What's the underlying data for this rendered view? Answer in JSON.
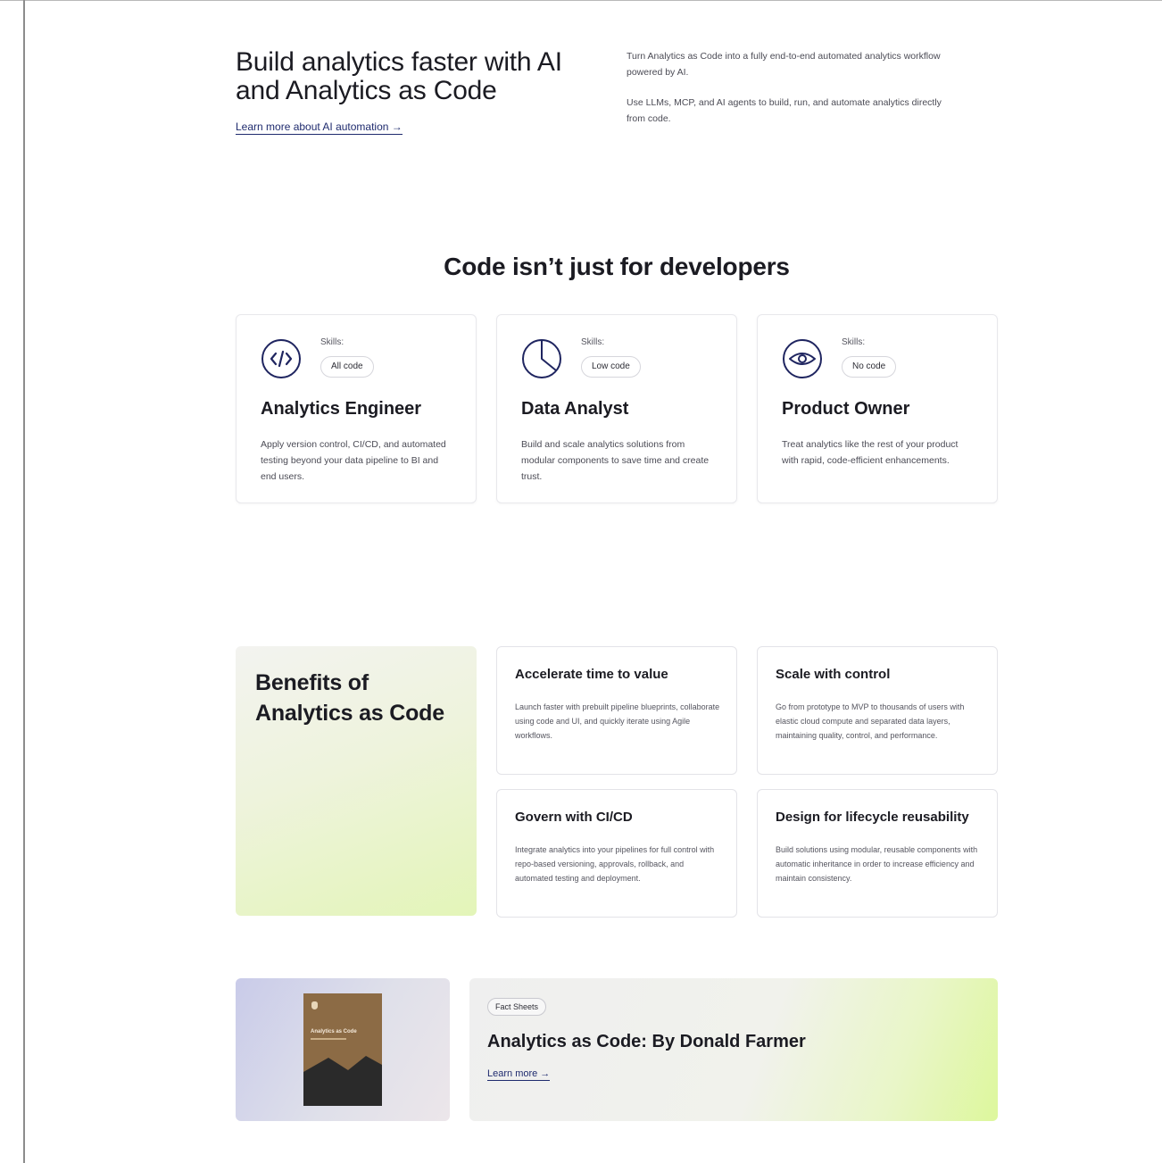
{
  "hero": {
    "title": "Build analytics faster with AI and Analytics as Code",
    "link_label": "Learn more about AI automation →",
    "paragraph_1": "Turn Analytics as Code into a fully end-to-end automated analytics workflow powered by AI.",
    "paragraph_2": "Use LLMs, MCP, and AI agents to build, run, and automate analytics directly from code."
  },
  "roles": {
    "section_title": "Code isn’t just for developers",
    "skills_label": "Skills:",
    "items": [
      {
        "icon": "code-brackets-icon",
        "skill": "All code",
        "title": "Analytics Engineer",
        "description": "Apply version control, CI/CD, and automated testing beyond your data pipeline to BI and end users."
      },
      {
        "icon": "pie-chart-icon",
        "skill": "Low code",
        "title": "Data Analyst",
        "description": "Build and scale analytics solutions from modular components to save time and create trust."
      },
      {
        "icon": "eye-icon",
        "skill": "No code",
        "title": "Product Owner",
        "description": "Treat analytics like the rest of your product with rapid, code-efficient enhancements."
      }
    ]
  },
  "benefits": {
    "title": "Benefits of Analytics as Code",
    "items": [
      {
        "title": "Accelerate time to value",
        "description": "Launch faster with prebuilt pipeline blueprints, collaborate using code and UI, and quickly iterate using Agile workflows."
      },
      {
        "title": "Scale with control",
        "description": "Go from prototype to MVP to thousands of users with elastic cloud compute and separated data layers, maintaining quality, control, and performance."
      },
      {
        "title": "Govern with CI/CD",
        "description": "Integrate analytics into your pipelines for full control with repo-based versioning, approvals, rollback, and automated testing and deployment."
      },
      {
        "title": "Design for lifecycle reusability",
        "description": "Build solutions using modular, reusable components with automatic inheritance in order to increase efficiency and maintain consistency."
      }
    ]
  },
  "resource": {
    "chip": "Fact Sheets",
    "title": "Analytics as Code: By Donald Farmer",
    "link_label": "Learn more →",
    "book_title": "Analytics as Code"
  },
  "colors": {
    "accent_link": "#1f2b6e",
    "icon_stroke": "#1f2560",
    "lime_gradient_end": "#ddf79c"
  }
}
